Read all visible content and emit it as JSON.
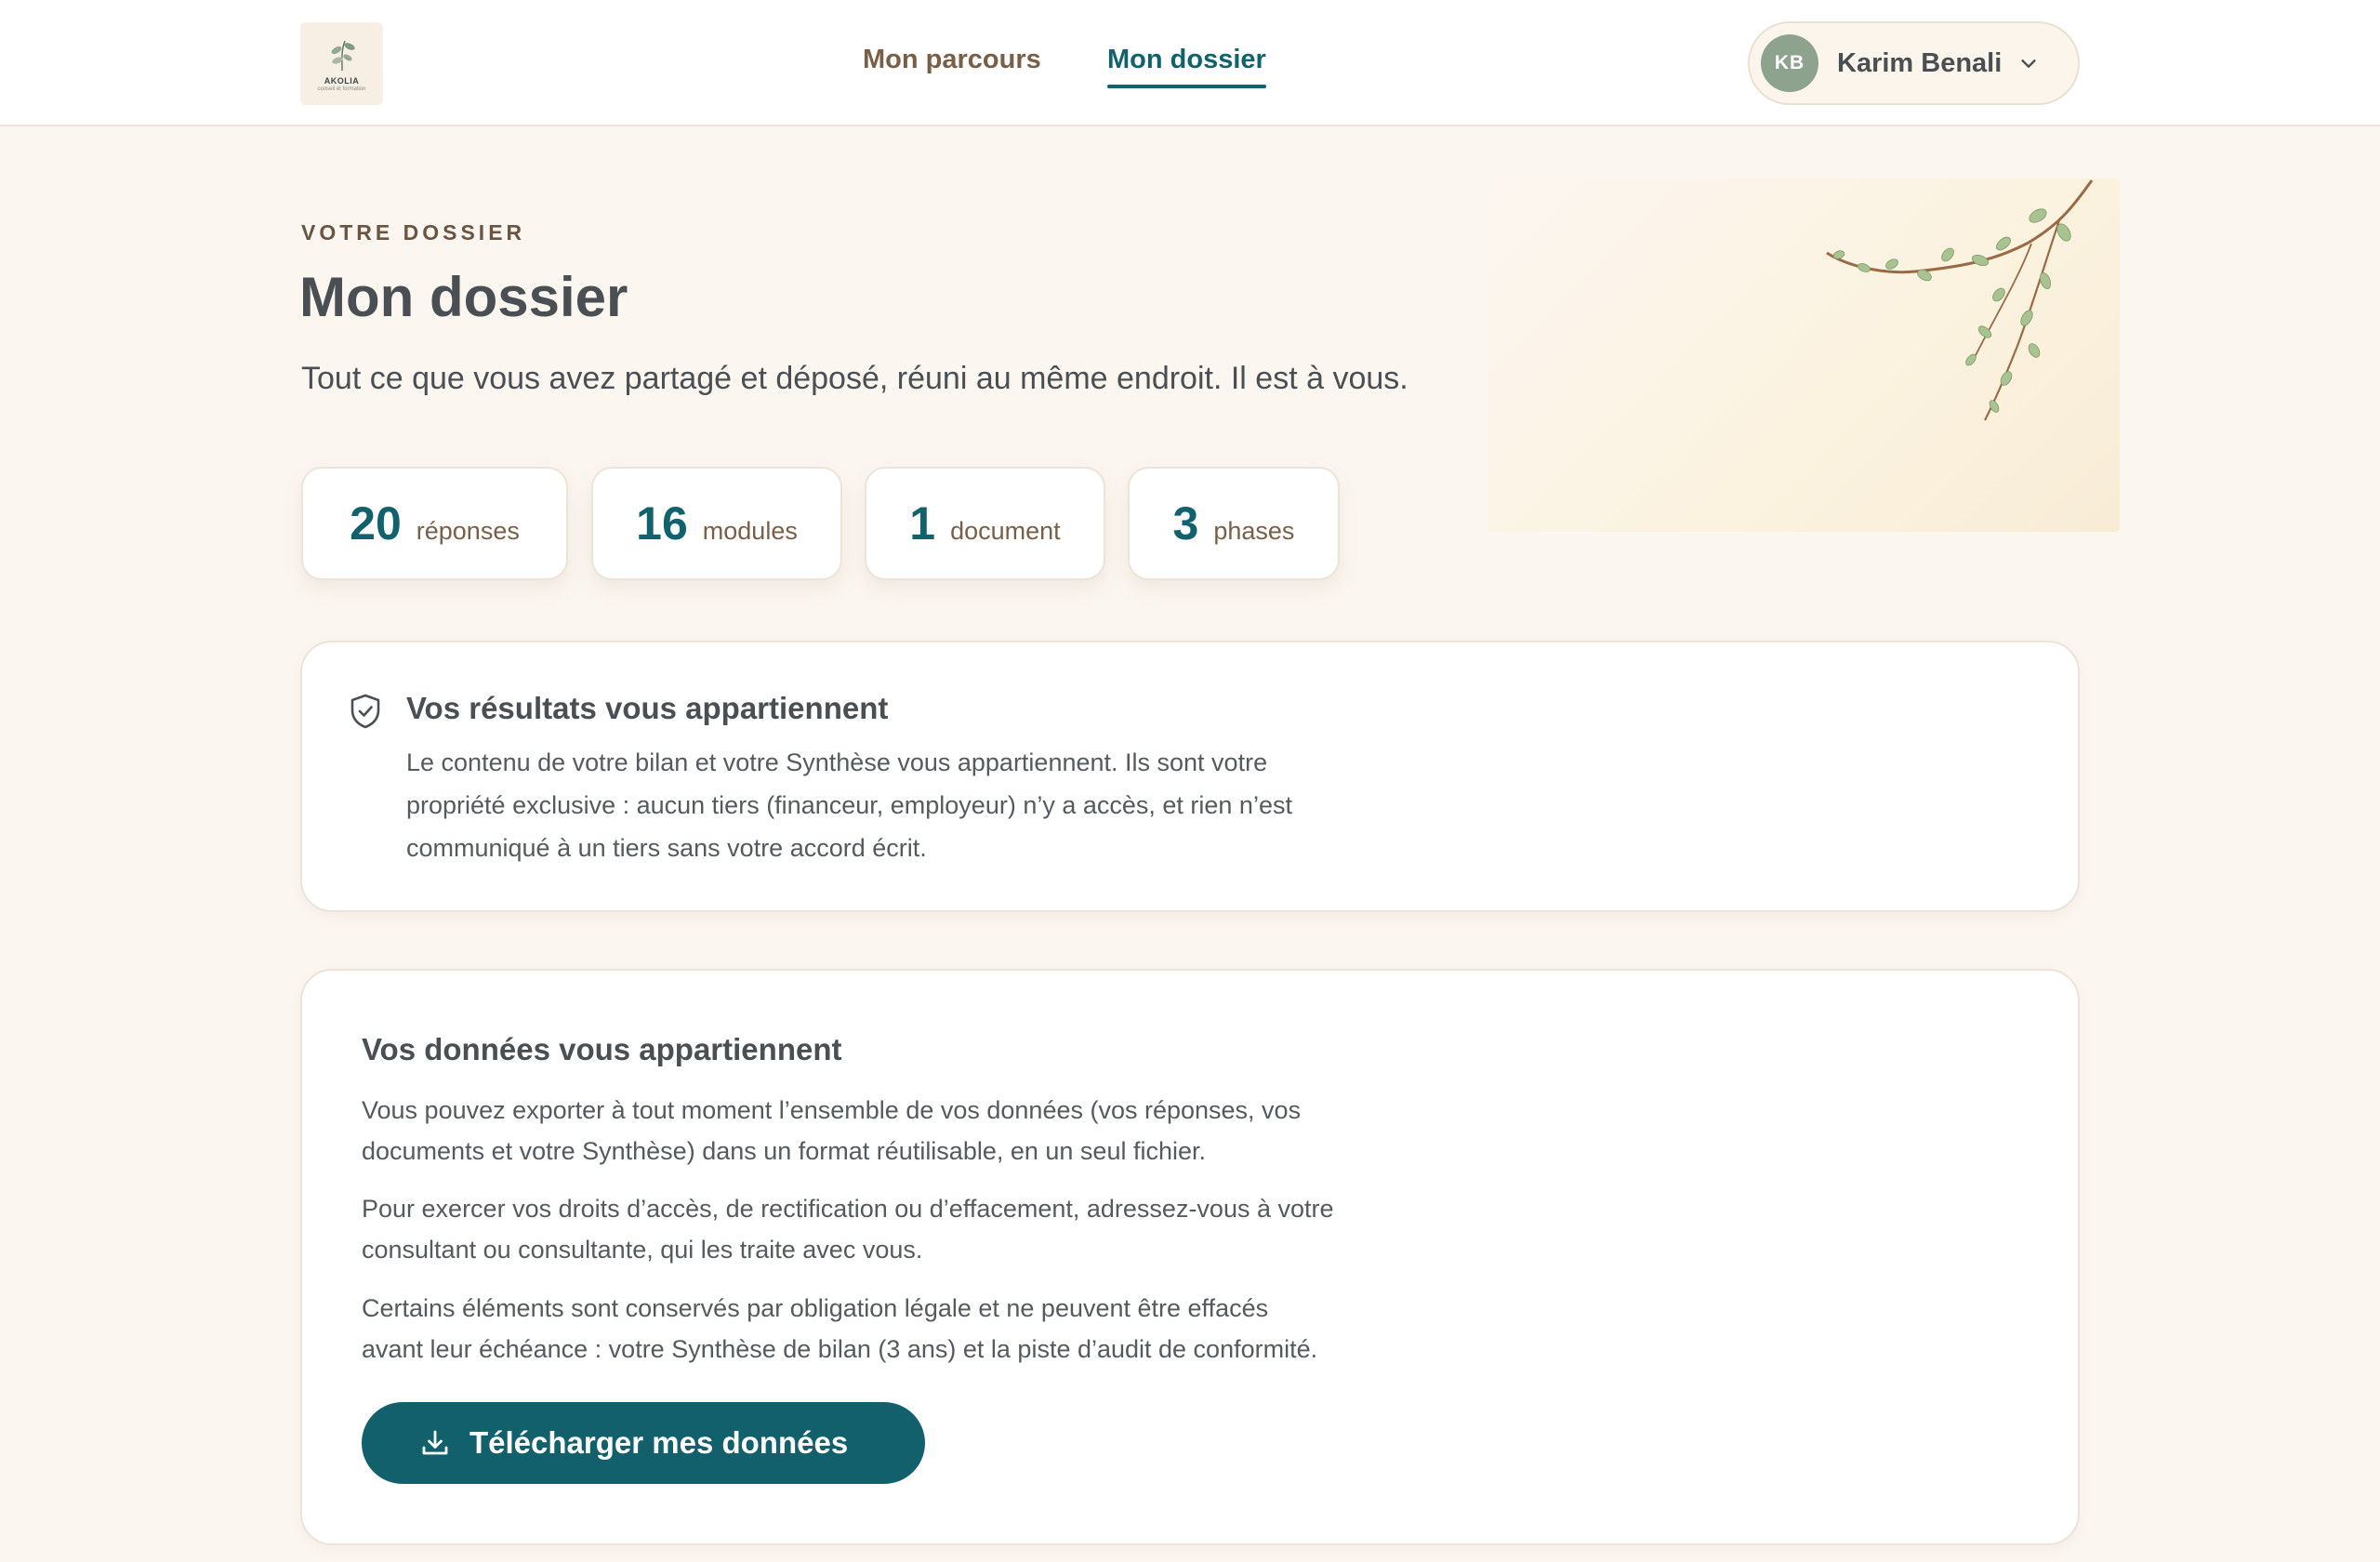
{
  "header": {
    "logo": {
      "name": "AKOLIA",
      "tagline": "conseil et formation"
    },
    "nav": [
      {
        "label": "Mon parcours",
        "active": false
      },
      {
        "label": "Mon dossier",
        "active": true
      }
    ],
    "user": {
      "initials": "KB",
      "name": "Karim Benali"
    }
  },
  "hero": {
    "eyebrow": "VOTRE DOSSIER",
    "title": "Mon dossier",
    "subtitle": "Tout ce que vous avez partagé et déposé, réuni au même endroit. Il est à vous."
  },
  "stats": [
    {
      "value": "20",
      "label": "réponses"
    },
    {
      "value": "16",
      "label": "modules"
    },
    {
      "value": "1",
      "label": "document"
    },
    {
      "value": "3",
      "label": "phases"
    }
  ],
  "ownership_card": {
    "title": "Vos résultats vous appartiennent",
    "body_lines": [
      "Le contenu de votre bilan et votre Synthèse vous appartiennent. Ils sont votre",
      "propriété exclusive : aucun tiers (financeur, employeur) n’y a accès, et rien n’est",
      "communiqué à un tiers sans votre accord écrit."
    ]
  },
  "data_card": {
    "title": "Vos données vous appartiennent",
    "paragraphs": [
      [
        "Vous pouvez exporter à tout moment l’ensemble de vos données (vos réponses, vos",
        "documents et votre Synthèse) dans un format réutilisable, en un seul fichier."
      ],
      [
        "Pour exercer vos droits d’accès, de rectification ou d’effacement, adressez-vous à votre",
        "consultant ou consultante, qui les traite avec vous."
      ],
      [
        "Certains éléments sont conservés par obligation légale et ne peuvent être effacés",
        "avant leur échéance : votre Synthèse de bilan (3 ans) et la piste d’audit de conformité."
      ]
    ],
    "button_label": "Télécharger mes données"
  },
  "colors": {
    "accent": "#12626d",
    "background": "#fcf6f0",
    "brown": "#7a5f48",
    "avatar": "#8da38e"
  }
}
